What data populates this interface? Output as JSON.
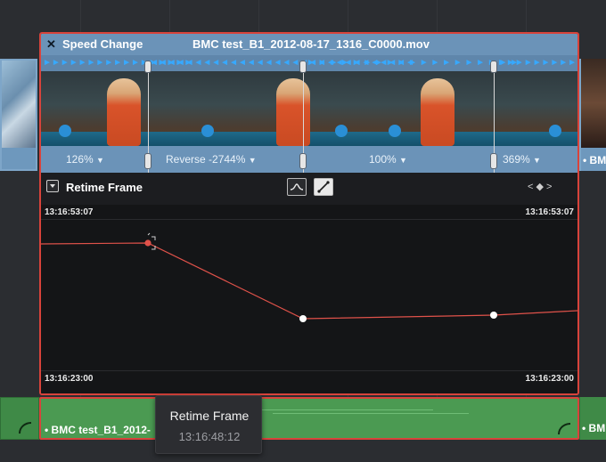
{
  "speed_change": {
    "title": "Speed Change",
    "file_name": "BMC test_B1_2012-08-17_1316_C0000.mov",
    "segments": [
      {
        "label": "126%",
        "arrow": "▼"
      },
      {
        "label": "Reverse -2744%",
        "arrow": "▼"
      },
      {
        "label": "100%",
        "arrow": "▼"
      },
      {
        "label": "369%",
        "arrow": "▼"
      }
    ]
  },
  "retime": {
    "label": "Retime Frame",
    "top_left_tc": "13:16:53:07",
    "top_right_tc": "13:16:53:07",
    "bottom_left_tc": "13:16:23:00",
    "bottom_right_tc": "13:16:23:00",
    "nav_arrows": "< ◆ >"
  },
  "clips": {
    "right_video_label": "• BMC",
    "audio_label": "• BMC test_B1_2012-",
    "audio_right_label": "• BM"
  },
  "tooltip": {
    "title": "Retime Frame",
    "value": "13:16:48:12"
  },
  "colors": {
    "selection_border": "#d8433b",
    "video_clip": "#6b93b8",
    "audio_clip": "#4b9a52",
    "direction_arrows": "#37a9ff",
    "curve": "#e0524a"
  },
  "icons": {
    "close": "close-icon",
    "dropdown": "dropdown-icon",
    "curve_ease": "ease-curve-icon",
    "curve_linear": "linear-curve-icon",
    "audio_link": "audio-link-icon"
  }
}
